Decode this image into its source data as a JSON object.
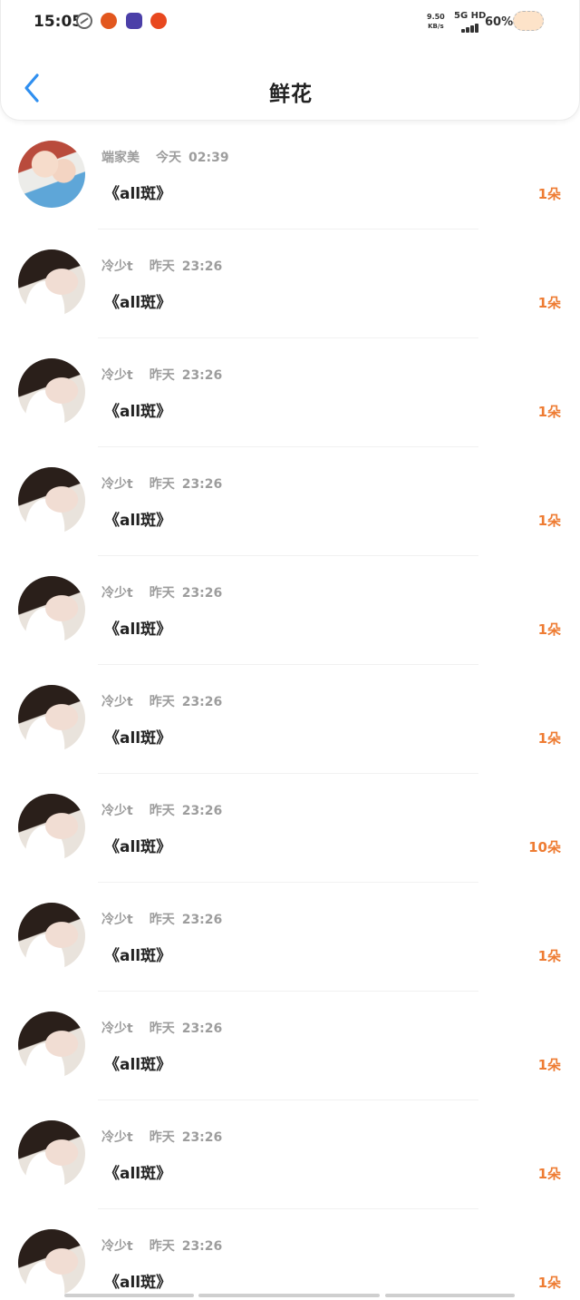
{
  "status_bar": {
    "time": "15:05",
    "net_speed_value": "9.50",
    "net_speed_unit": "KB/s",
    "net_type": "5G HD",
    "battery_percent": "60%"
  },
  "header": {
    "title": "鲜花",
    "back_icon": "chevron-left-icon"
  },
  "colors": {
    "accent": "#2f8ff0",
    "count": "#ee7c33",
    "meta_text": "#9d9d9d"
  },
  "records": [
    {
      "name": "端家美",
      "day": "今天",
      "time": "02:39",
      "message": "《all斑》",
      "count": "1朵",
      "avatar": "couple"
    },
    {
      "name": "冷少t",
      "day": "昨天",
      "time": "23:26",
      "message": "《all斑》",
      "count": "1朵",
      "avatar": "boy"
    },
    {
      "name": "冷少t",
      "day": "昨天",
      "time": "23:26",
      "message": "《all斑》",
      "count": "1朵",
      "avatar": "boy"
    },
    {
      "name": "冷少t",
      "day": "昨天",
      "time": "23:26",
      "message": "《all斑》",
      "count": "1朵",
      "avatar": "boy"
    },
    {
      "name": "冷少t",
      "day": "昨天",
      "time": "23:26",
      "message": "《all斑》",
      "count": "1朵",
      "avatar": "boy"
    },
    {
      "name": "冷少t",
      "day": "昨天",
      "time": "23:26",
      "message": "《all斑》",
      "count": "1朵",
      "avatar": "boy"
    },
    {
      "name": "冷少t",
      "day": "昨天",
      "time": "23:26",
      "message": "《all斑》",
      "count": "10朵",
      "avatar": "boy"
    },
    {
      "name": "冷少t",
      "day": "昨天",
      "time": "23:26",
      "message": "《all斑》",
      "count": "1朵",
      "avatar": "boy"
    },
    {
      "name": "冷少t",
      "day": "昨天",
      "time": "23:26",
      "message": "《all斑》",
      "count": "1朵",
      "avatar": "boy"
    },
    {
      "name": "冷少t",
      "day": "昨天",
      "time": "23:26",
      "message": "《all斑》",
      "count": "1朵",
      "avatar": "boy"
    },
    {
      "name": "冷少t",
      "day": "昨天",
      "time": "23:26",
      "message": "《all斑》",
      "count": "1朵",
      "avatar": "boy"
    }
  ]
}
